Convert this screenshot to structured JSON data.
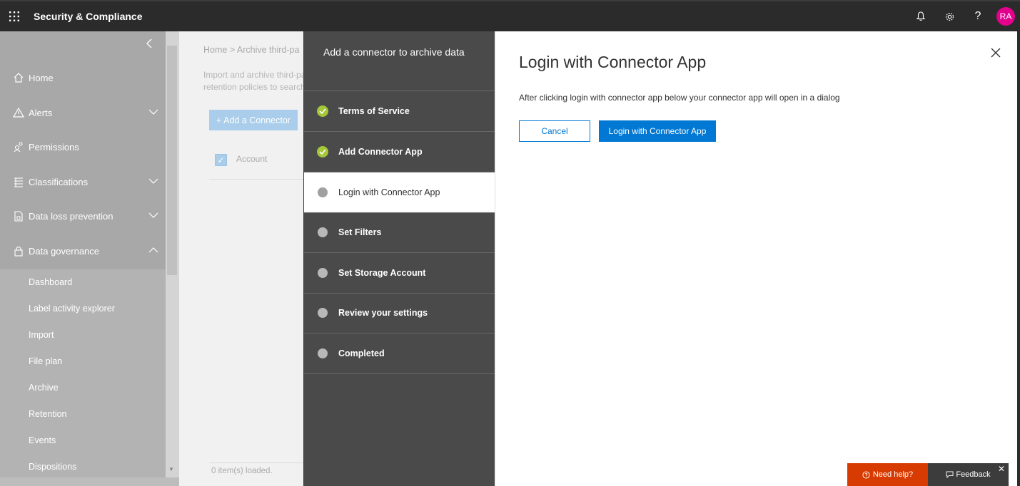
{
  "topbar": {
    "app_title": "Security & Compliance",
    "icons": [
      "waffle-icon",
      "bell-icon",
      "gear-icon",
      "help-icon"
    ],
    "help_glyph": "?",
    "avatar_initials": "RA",
    "avatar_color": "#e3008c"
  },
  "sidebar": {
    "items": [
      {
        "label": "Home",
        "icon": "home-icon"
      },
      {
        "label": "Alerts",
        "icon": "alert-icon"
      },
      {
        "label": "Permissions",
        "icon": "permissions-icon"
      },
      {
        "label": "Classifications",
        "icon": "classifications-icon"
      },
      {
        "label": "Data loss prevention",
        "icon": "dlp-icon"
      },
      {
        "label": "Data governance",
        "icon": "lock-icon"
      }
    ],
    "sub_items": [
      "Dashboard",
      "Label activity explorer",
      "Import",
      "File plan",
      "Archive",
      "Retention",
      "Events",
      "Dispositions"
    ]
  },
  "content": {
    "breadcrumb": "Home  >  Archive third-pa",
    "desc_line1": "Import and archive third-pa",
    "desc_line2": "retention policies to search",
    "add_button": "+ Add a Connector",
    "column_account": "Account",
    "items_loaded": "0 item(s) loaded."
  },
  "wizard": {
    "title": "Add a connector to archive data",
    "steps": [
      {
        "label": "Terms of Service",
        "status": "done"
      },
      {
        "label": "Add Connector App",
        "status": "done"
      },
      {
        "label": "Login with Connector App",
        "status": "active"
      },
      {
        "label": "Set Filters",
        "status": "pending"
      },
      {
        "label": "Set Storage Account",
        "status": "pending"
      },
      {
        "label": "Review your settings",
        "status": "pending"
      },
      {
        "label": "Completed",
        "status": "pending"
      }
    ]
  },
  "panel": {
    "title": "Login with Connector App",
    "text": "After clicking login with connector app below your connector app will open in a dialog",
    "cancel_label": "Cancel",
    "login_label": "Login with Connector App",
    "accent_color": "#0078d4"
  },
  "help": {
    "need_help": "Need help?",
    "feedback": "Feedback",
    "close_glyph": "✕",
    "need_help_color": "#d83b01"
  }
}
